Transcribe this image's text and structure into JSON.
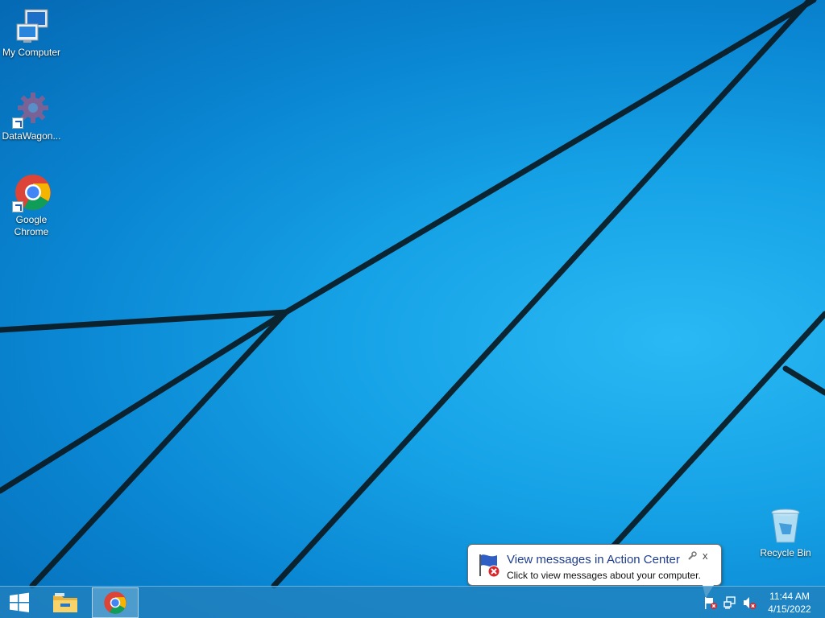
{
  "desktop": {
    "icons": [
      {
        "label": "My Computer",
        "icon": "computer-icon",
        "shortcut": false
      },
      {
        "label": "DataWagon...",
        "icon": "datawagon-gear-icon",
        "shortcut": true
      },
      {
        "label": "Google Chrome",
        "icon": "chrome-icon",
        "shortcut": true
      },
      {
        "label": "Recycle Bin",
        "icon": "recycle-bin-icon",
        "shortcut": false
      }
    ]
  },
  "notification": {
    "title": "View messages in Action Center",
    "body": "Click to view messages about your computer.",
    "close_label": "x",
    "icon": "action-center-flag-icon"
  },
  "taskbar": {
    "items": [
      {
        "name": "start",
        "icon": "windows-logo-icon"
      },
      {
        "name": "file-explorer",
        "icon": "folder-icon"
      },
      {
        "name": "google-chrome",
        "icon": "chrome-icon",
        "active": true
      }
    ],
    "tray": [
      {
        "name": "action-center",
        "icon": "flag-error-icon"
      },
      {
        "name": "network",
        "icon": "network-icon"
      },
      {
        "name": "volume",
        "icon": "volume-muted-icon"
      }
    ],
    "clock": {
      "time": "11:44 AM",
      "date": "4/15/2022"
    }
  },
  "colors": {
    "wallpaper": "#1aa6ea",
    "taskbar": "#2382be",
    "balloon_title": "#1e3d8f"
  }
}
